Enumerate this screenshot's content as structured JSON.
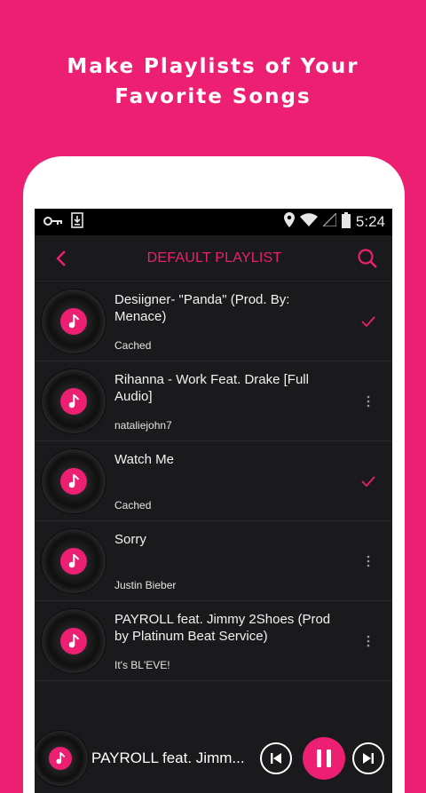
{
  "promo": {
    "line1": "Make Playlists of Your",
    "line2": "Favorite Songs"
  },
  "status_bar": {
    "time": "5:24",
    "icons": [
      "key-icon",
      "download-icon",
      "location-icon",
      "wifi-icon",
      "signal-icon",
      "battery-icon"
    ]
  },
  "app_bar": {
    "title": "DEFAULT PLAYLIST",
    "back_icon": "chevron-left-icon",
    "search_icon": "search-icon"
  },
  "songs": [
    {
      "title": "Desiigner- \"Panda\" (Prod. By: Menace)",
      "subtitle": "Cached",
      "action": "check-icon"
    },
    {
      "title": "Rihanna - Work Feat. Drake [Full Audio]",
      "subtitle": "nataliejohn7",
      "action": "more-vert-icon"
    },
    {
      "title": "Watch Me",
      "subtitle": "Cached",
      "action": "check-icon"
    },
    {
      "title": "Sorry",
      "subtitle": "Justin Bieber",
      "action": "more-vert-icon"
    },
    {
      "title": "PAYROLL feat. Jimmy 2Shoes (Prod by Platinum Beat Service)",
      "subtitle": "It's BL'EVE!",
      "action": "more-vert-icon"
    }
  ],
  "now_playing": {
    "track": "PAYROLL feat. Jimm...",
    "controls": [
      "previous-icon",
      "pause-icon",
      "next-icon"
    ]
  },
  "colors": {
    "accent": "#ec1f72",
    "background": "#1a1a1c",
    "text": "#f2f2f2"
  }
}
